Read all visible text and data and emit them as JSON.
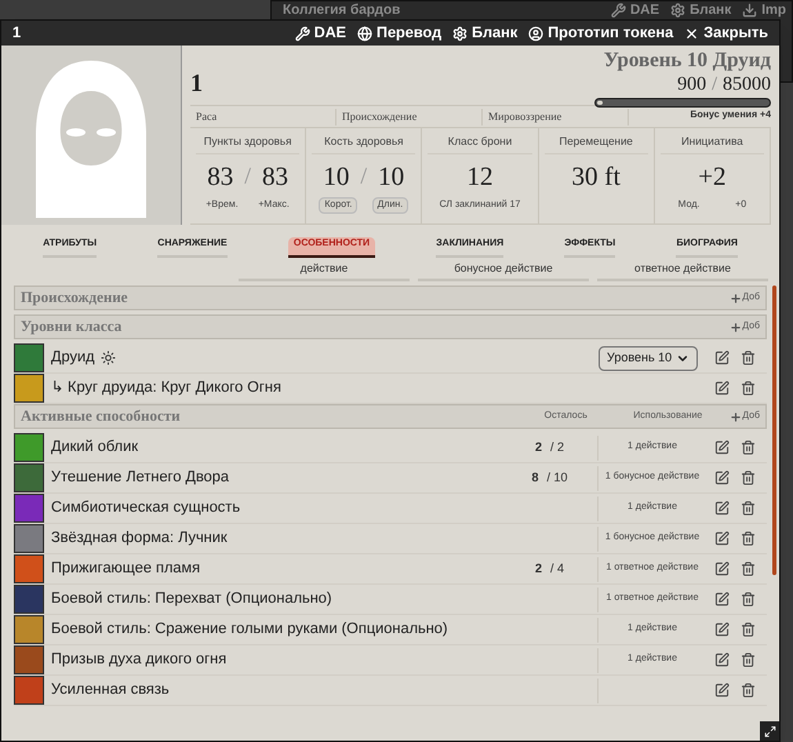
{
  "back_window": {
    "title": "Коллегия бардов",
    "buttons": [
      {
        "label": "DAE"
      },
      {
        "label": "Бланк"
      },
      {
        "label": "Imp"
      }
    ]
  },
  "window": {
    "title": "1",
    "buttons": [
      {
        "label": "DAE"
      },
      {
        "label": "Перевод"
      },
      {
        "label": "Бланк"
      },
      {
        "label": "Прототип токена"
      },
      {
        "label": "Закрыть"
      }
    ]
  },
  "character": {
    "name": "1",
    "class_level": "Уровень 10 Друид",
    "xp_current": "900",
    "xp_sep": "/",
    "xp_max": "85000",
    "xp": {
      "level": 0.01
    },
    "details": [
      {
        "label": "Раса"
      },
      {
        "label": "Происхождение"
      },
      {
        "label": "Мировоззрение"
      }
    ],
    "proficiency": "Бонус умения +4"
  },
  "stats": [
    {
      "label": "Пункты здоровья",
      "kind": "pair",
      "value": "83",
      "sep": "/",
      "max": "83",
      "sub": [
        "+Врем.",
        "+Макс."
      ]
    },
    {
      "label": "Кость здоровья",
      "kind": "pair_buttons",
      "value": "10",
      "sep": "/",
      "max": "10",
      "sub": [
        "Корот.",
        "Длин."
      ]
    },
    {
      "label": "Класс брони",
      "kind": "single",
      "value": "12",
      "sub": [
        "СЛ заклинаний 17"
      ]
    },
    {
      "label": "Перемещение",
      "kind": "single",
      "value": "30 ft"
    },
    {
      "label": "Инициатива",
      "kind": "single",
      "value": "+2",
      "sub": [
        "Мод.",
        "+0"
      ]
    }
  ],
  "tabs": [
    {
      "label": "АТРИБУТЫ",
      "selected": false
    },
    {
      "label": "СНАРЯЖЕНИЕ",
      "selected": false
    },
    {
      "label": "ОСОБЕННОСТИ",
      "selected": true
    },
    {
      "label": "ЗАКЛИНАНИЯ",
      "selected": false
    },
    {
      "label": "ЭФФЕКТЫ",
      "selected": false
    },
    {
      "label": "БИОГРАФИЯ",
      "selected": false
    }
  ],
  "filters": [
    {
      "label": "действие"
    },
    {
      "label": "бонусное действие"
    },
    {
      "label": "ответное действие"
    }
  ],
  "sections": [
    {
      "title": "Происхождение",
      "add": "Доб"
    },
    {
      "title": "Уровни класса",
      "add": "Доб",
      "items": [
        {
          "name": "Друид",
          "kind": "class",
          "color": "#2f7a3a",
          "level_select": "Уровень 10"
        },
        {
          "name": "↳ Круг друида: Круг Дикого Огня",
          "kind": "subclass",
          "color": "#c89a1c"
        }
      ]
    },
    {
      "title": "Активные способности",
      "add": "Доб",
      "columns": [
        "Осталось",
        "Использование"
      ],
      "items": [
        {
          "name": "Дикий облик",
          "kind": "feature",
          "color": "#3f9a2a",
          "uses": "2",
          "uses_max": "/ 2",
          "usage": "1 действие"
        },
        {
          "name": "Утешение Летнего Двора",
          "kind": "feature",
          "color": "#3d6a3a",
          "uses": "8",
          "uses_max": "/ 10",
          "usage": "1 бонусное действие"
        },
        {
          "name": "Симбиотическая сущность",
          "kind": "feature",
          "color": "#7a2ab8",
          "usage": "1 действие"
        },
        {
          "name": "Звёздная форма: Лучник",
          "kind": "feature",
          "color": "#7a7a80",
          "usage": "1 бонусное действие"
        },
        {
          "name": "Прижигающее пламя",
          "kind": "feature",
          "color": "#d0501a",
          "uses": "2",
          "uses_max": "/ 4",
          "usage": "1 ответное действие"
        },
        {
          "name": "Боевой стиль: Перехват (Опционально)",
          "kind": "feature",
          "color": "#2a3560",
          "usage": "1 ответное действие"
        },
        {
          "name": "Боевой стиль: Сражение голыми руками (Опционально)",
          "kind": "feature",
          "color": "#b8862a",
          "usage": "1 действие"
        },
        {
          "name": "Призыв духа дикого огня",
          "kind": "feature",
          "color": "#9a4a1c",
          "usage": "1 действие"
        },
        {
          "name": "Усиленная связь",
          "kind": "feature",
          "color": "#c0401a"
        }
      ]
    }
  ]
}
